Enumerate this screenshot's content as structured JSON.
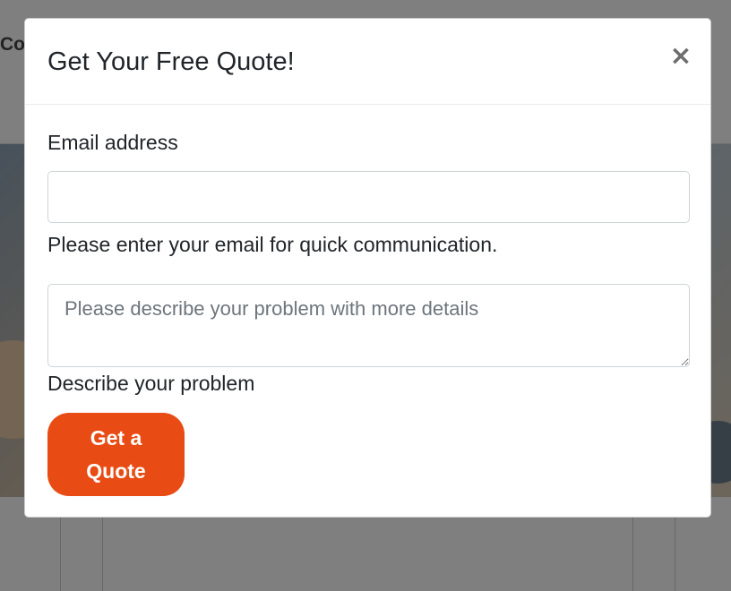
{
  "page": {
    "header_text": "Co"
  },
  "modal": {
    "title": "Get Your Free Quote!",
    "close_glyph": "×",
    "close_icon": "close-icon",
    "email": {
      "label": "Email address",
      "value": "",
      "help": "Please enter your email for quick communication."
    },
    "problem": {
      "value": "",
      "placeholder": "Please describe your problem with more details",
      "label": "Describe your problem"
    },
    "submit_label": "Get a Quote"
  },
  "colors": {
    "accent": "#e84c14",
    "backdrop": "rgba(0,0,0,0.5)",
    "title_text": "#212529",
    "placeholder_text": "#6c757d"
  }
}
